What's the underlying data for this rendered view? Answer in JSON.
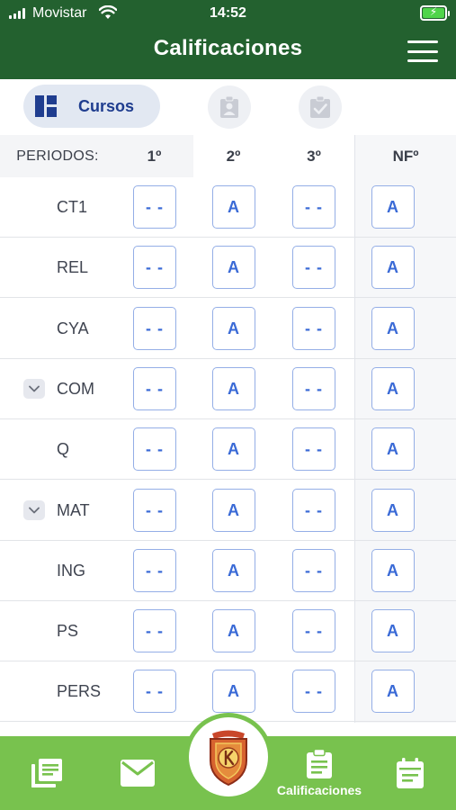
{
  "status": {
    "carrier": "Movistar",
    "time": "14:52"
  },
  "header": {
    "title": "Calificaciones"
  },
  "tabs": {
    "cursos_label": "Cursos"
  },
  "table": {
    "periods_label": "PERIODOS:",
    "columns": [
      "1º",
      "2º",
      "3º",
      "NFº"
    ],
    "rows": [
      {
        "course": "CT1",
        "grades": [
          "- -",
          "A",
          "- -",
          "A"
        ],
        "expandable": false
      },
      {
        "course": "REL",
        "grades": [
          "- -",
          "A",
          "- -",
          "A"
        ],
        "expandable": false
      },
      {
        "course": "CYA",
        "grades": [
          "- -",
          "A",
          "- -",
          "A"
        ],
        "expandable": false
      },
      {
        "course": "COM",
        "grades": [
          "- -",
          "A",
          "- -",
          "A"
        ],
        "expandable": true
      },
      {
        "course": "Q",
        "grades": [
          "- -",
          "A",
          "- -",
          "A"
        ],
        "expandable": false
      },
      {
        "course": "MAT",
        "grades": [
          "- -",
          "A",
          "- -",
          "A"
        ],
        "expandable": true
      },
      {
        "course": "ING",
        "grades": [
          "- -",
          "A",
          "- -",
          "A"
        ],
        "expandable": false
      },
      {
        "course": "PS",
        "grades": [
          "- -",
          "A",
          "- -",
          "A"
        ],
        "expandable": false
      },
      {
        "course": "PERS",
        "grades": [
          "- -",
          "A",
          "- -",
          "A"
        ],
        "expandable": false
      }
    ]
  },
  "bottom_nav": {
    "active_label": "Calificaciones",
    "items": [
      "book-icon",
      "mail-icon",
      "school-logo",
      "clipboard-icon",
      "calendar-icon"
    ]
  },
  "colors": {
    "header": "#23612f",
    "nav": "#78c24e",
    "accent": "#1f3d8f",
    "grade": "#3a6ad6"
  }
}
